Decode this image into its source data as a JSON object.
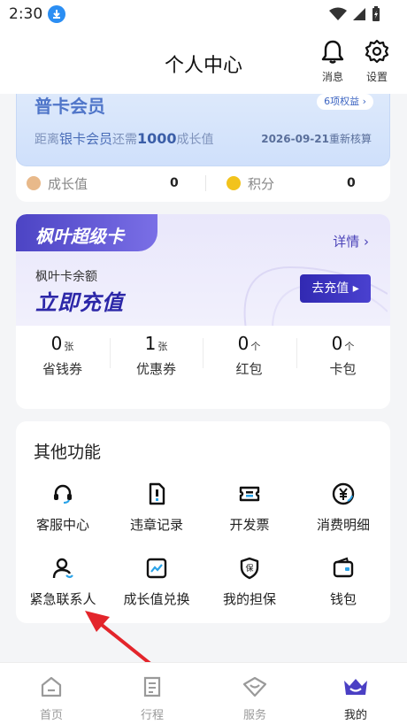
{
  "status_bar": {
    "time": "2:30"
  },
  "header": {
    "title": "个人中心",
    "messages_label": "消息",
    "settings_label": "设置"
  },
  "member": {
    "title": "普卡会员",
    "benefits_badge": "6项权益 ›",
    "desc_prefix": "距离",
    "desc_target": "银卡会员",
    "desc_mid": "还需",
    "desc_points": "1000",
    "desc_suffix": "成长值",
    "reset_date": "2026-09-21",
    "reset_suffix": "重新核算",
    "growth_label": "成长值",
    "growth_value": "0",
    "points_label": "积分",
    "points_value": "0"
  },
  "super_card": {
    "tab_title": "枫叶超级卡",
    "detail_label": "详情 ›",
    "balance_label": "枫叶卡余额",
    "cta_title": "立即充值",
    "recharge_button": "去充值 ▸",
    "coupons": [
      {
        "count": "0",
        "unit": "张",
        "name": "省钱券"
      },
      {
        "count": "1",
        "unit": "张",
        "name": "优惠券"
      },
      {
        "count": "0",
        "unit": "个",
        "name": "红包"
      },
      {
        "count": "0",
        "unit": "个",
        "name": "卡包"
      }
    ]
  },
  "other_functions": {
    "title": "其他功能",
    "items": [
      {
        "label": "客服中心",
        "icon": "headset-icon"
      },
      {
        "label": "违章记录",
        "icon": "violation-record-icon"
      },
      {
        "label": "开发票",
        "icon": "invoice-ticket-icon"
      },
      {
        "label": "消费明细",
        "icon": "yen-coin-icon"
      },
      {
        "label": "紧急联系人",
        "icon": "emergency-contact-icon"
      },
      {
        "label": "成长值兑换",
        "icon": "growth-chart-icon"
      },
      {
        "label": "我的担保",
        "icon": "guarantee-shield-icon"
      },
      {
        "label": "钱包",
        "icon": "wallet-icon"
      }
    ]
  },
  "bottom_nav": {
    "items": [
      {
        "label": "首页",
        "icon": "home-icon"
      },
      {
        "label": "行程",
        "icon": "trip-icon"
      },
      {
        "label": "服务",
        "icon": "service-icon"
      },
      {
        "label": "我的",
        "icon": "profile-crown-icon"
      }
    ],
    "active_label": "我的"
  },
  "colors": {
    "accent": "#3129b2",
    "member_blue": "#5076c9",
    "arrow": "#e3252b"
  }
}
